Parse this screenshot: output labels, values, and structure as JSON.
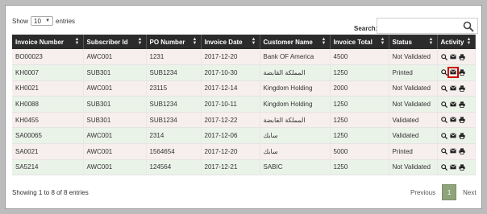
{
  "length_menu": {
    "show_label": "Show",
    "value": "10",
    "entries_label": "entries"
  },
  "search": {
    "label": "Search:",
    "value": ""
  },
  "table": {
    "columns": [
      "Invoice Number",
      "Subscriber Id",
      "PO Number",
      "Invoice Date",
      "Customer Name",
      "Invoice Total",
      "Status",
      "Activity"
    ],
    "rows": [
      [
        "BO00023",
        "AWC001",
        "1231",
        "2017-12-20",
        "Bank OF America",
        "4500",
        "Not Validated"
      ],
      [
        "KH0007",
        "SUB301",
        "SUB1234",
        "2017-10-30",
        "المملكة القابضة",
        "1250",
        "Printed"
      ],
      [
        "KH0021",
        "AWC001",
        "23115",
        "2017-12-14",
        "Kingdom Holding",
        "2000",
        "Not Validated"
      ],
      [
        "KH0088",
        "SUB301",
        "SUB1234",
        "2017-10-11",
        "Kingdom Holding",
        "1250",
        "Not Validated"
      ],
      [
        "KH0455",
        "SUB301",
        "SUB1234",
        "2017-12-22",
        "المملكة القابضة",
        "1250",
        "Validated"
      ],
      [
        "SA00065",
        "AWC001",
        "2314",
        "2017-12-06",
        "سابك",
        "1250",
        "Validated"
      ],
      [
        "SA0021",
        "AWC001",
        "1564654",
        "2017-12-20",
        "سابك",
        "5000",
        "Printed"
      ],
      [
        "SA5214",
        "AWC001",
        "124564",
        "2017-12-21",
        "SABIC",
        "1250",
        "Not Validated"
      ]
    ]
  },
  "info": "Showing 1 to 8 of 8 entries",
  "pagination": {
    "previous": "Previous",
    "page": "1",
    "next": "Next"
  },
  "colors": {
    "header_bg": "#2b2b2b",
    "odd_row": "#f7eeee",
    "even_row": "#eaf3e8",
    "active_page": "#8fa47a",
    "highlight": "#d00000"
  }
}
